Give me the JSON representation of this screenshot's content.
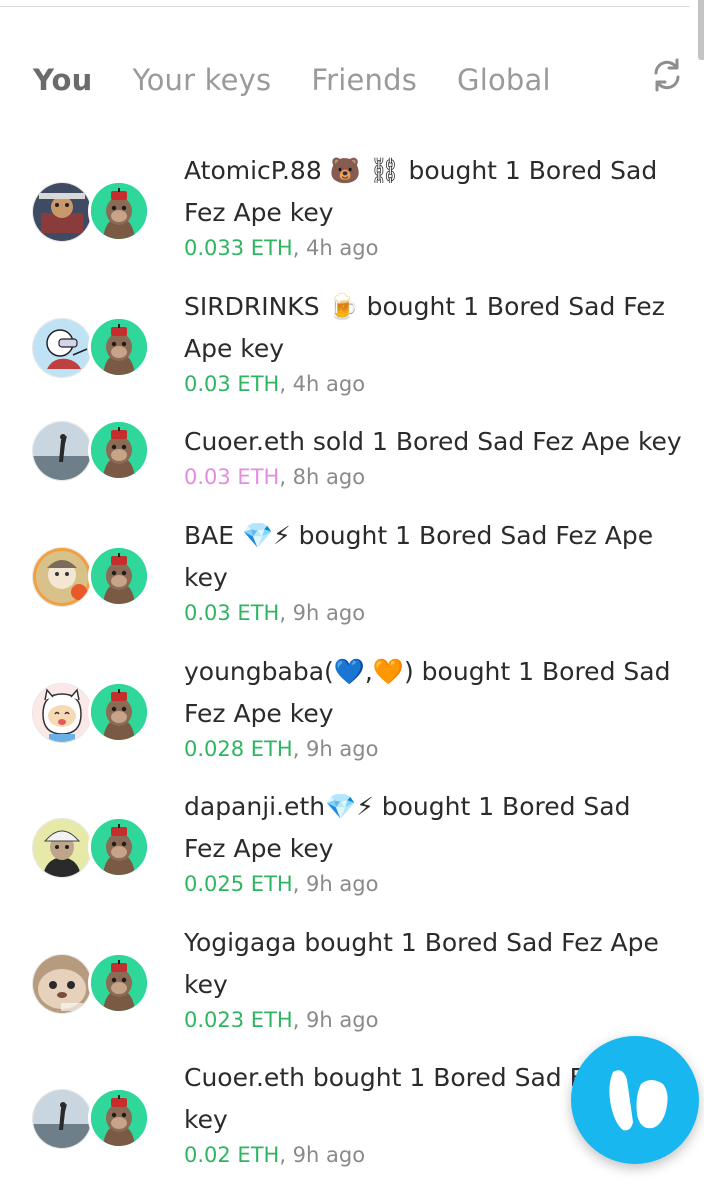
{
  "tabs": [
    {
      "label": "You",
      "active": true
    },
    {
      "label": "Your keys",
      "active": false
    },
    {
      "label": "Friends",
      "active": false
    },
    {
      "label": "Global",
      "active": false
    }
  ],
  "icons": {
    "refresh": "refresh-icon",
    "fab": "friend-tech-logo-icon"
  },
  "colors": {
    "buy": "#2fb562",
    "sell": "#e58ce0",
    "ape_bg": "#2fd89a",
    "fab": "#18b7ef"
  },
  "feed": [
    {
      "line1": "AtomicP.88 🐻 ⛓ bought 1 Bored Sad",
      "line2": "Fez Ape key",
      "amount": "0.033 ETH",
      "time": ", 4h ago",
      "type": "buy"
    },
    {
      "line1": "SIRDRINKS 🍺 bought 1 Bored Sad Fez",
      "line2": "Ape key",
      "amount": "0.03 ETH",
      "time": ", 4h ago",
      "type": "buy"
    },
    {
      "line1": "Cuoer.eth sold 1 Bored Sad Fez Ape key",
      "line2": "",
      "amount": "0.03 ETH",
      "time": ", 8h ago",
      "type": "sell"
    },
    {
      "line1": "BAE 💎⚡ bought 1 Bored Sad Fez Ape",
      "line2": "key",
      "amount": "0.03 ETH",
      "time": ", 9h ago",
      "type": "buy"
    },
    {
      "line1": "youngbaba(💙,🧡) bought 1 Bored Sad",
      "line2": "Fez Ape key",
      "amount": "0.028 ETH",
      "time": ", 9h ago",
      "type": "buy"
    },
    {
      "line1": "dapanji.eth💎⚡ bought 1 Bored Sad",
      "line2": "Fez Ape key",
      "amount": "0.025 ETH",
      "time": ", 9h ago",
      "type": "buy"
    },
    {
      "line1": "Yogigaga bought 1 Bored Sad Fez Ape",
      "line2": "key",
      "amount": "0.023 ETH",
      "time": ", 9h ago",
      "type": "buy"
    },
    {
      "line1": "Cuoer.eth bought 1 Bored Sad F",
      "line2": "key",
      "amount": "0.02 ETH",
      "time": ", 9h ago",
      "type": "buy"
    }
  ]
}
